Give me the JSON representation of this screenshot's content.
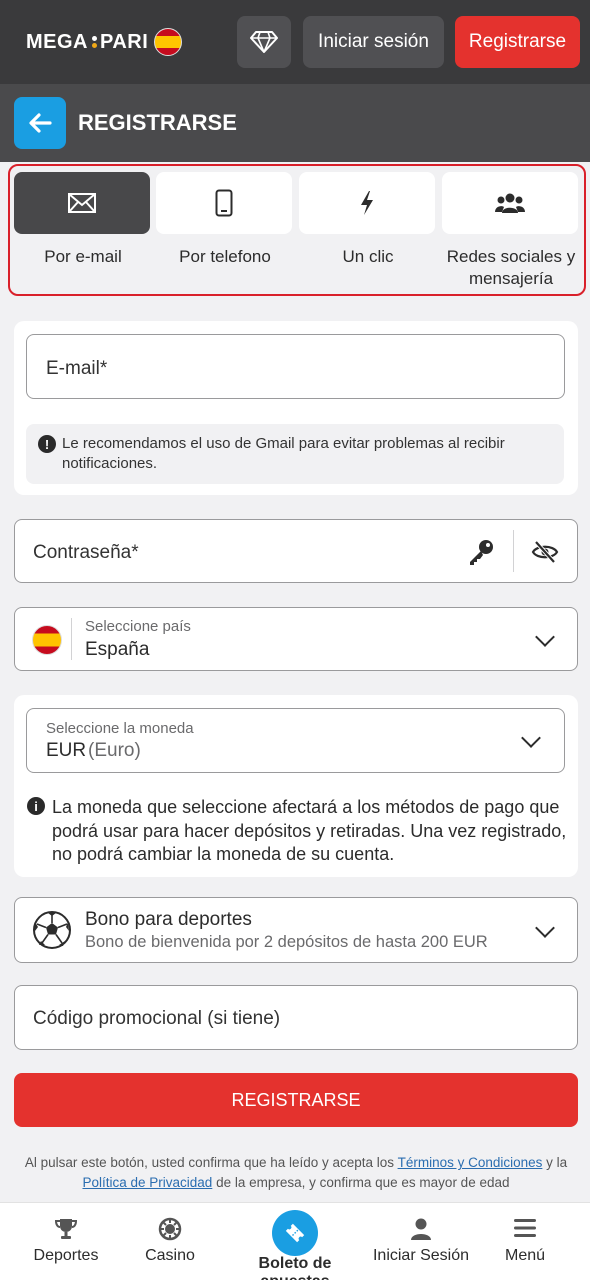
{
  "header": {
    "logo_left": "MEGA",
    "logo_right": "PARI",
    "login_label": "Iniciar sesión",
    "register_label": "Registrarse"
  },
  "subheader": {
    "title": "REGISTRARSE"
  },
  "methods": [
    {
      "label": "Por e-mail",
      "icon": "envelope-icon",
      "active": true
    },
    {
      "label": "Por telefono",
      "icon": "phone-icon",
      "active": false
    },
    {
      "label": "Un clic",
      "icon": "lightning-icon",
      "active": false
    },
    {
      "label": "Redes sociales y mensajería",
      "icon": "users-icon",
      "active": false
    }
  ],
  "email": {
    "placeholder": "E-mail*",
    "hint": "Le recomendamos el uso de Gmail para evitar problemas al recibir notificaciones."
  },
  "password": {
    "placeholder": "Contraseña*"
  },
  "country": {
    "label": "Seleccione país",
    "value": "España"
  },
  "currency": {
    "label": "Seleccione la moneda",
    "code": "EUR",
    "name": "(Euro)",
    "note": "La moneda que seleccione afectará a los métodos de pago que podrá usar para hacer depósitos y retiradas. Una vez registrado, no podrá cambiar la moneda de su cuenta."
  },
  "bonus": {
    "title": "Bono para deportes",
    "subtitle": "Bono de bienvenida por 2 depósitos de hasta 200 EUR"
  },
  "promo": {
    "placeholder": "Código promocional (si tiene)"
  },
  "submit_label": "REGISTRARSE",
  "terms": {
    "prefix": "Al pulsar este botón, usted confirma que ha leído y acepta los",
    "terms_link": "Términos y Condiciones",
    "middle": "y la",
    "privacy_link": "Política de Privacidad",
    "suffix": "de la empresa, y confirma que es mayor de edad"
  },
  "bottom_nav": [
    {
      "label": "Deportes",
      "icon": "trophy-icon"
    },
    {
      "label": "Casino",
      "icon": "casino-chip-icon"
    },
    {
      "label": "Boleto de apuestas",
      "icon": "ticket-icon"
    },
    {
      "label": "Iniciar Sesión",
      "icon": "user-icon"
    },
    {
      "label": "Menú",
      "icon": "hamburger-icon"
    }
  ],
  "colors": {
    "accent_red": "#e4322e",
    "accent_blue": "#1a9ee2",
    "header_dark": "#3a3a3c"
  }
}
